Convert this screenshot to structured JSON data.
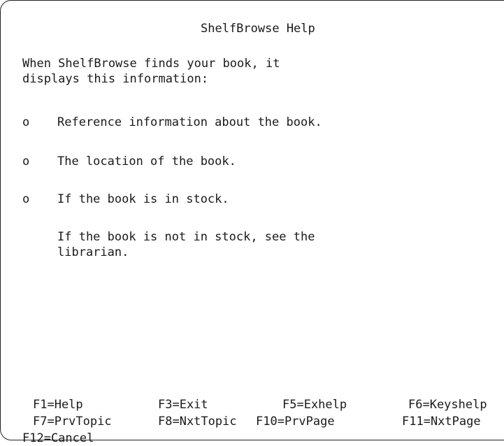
{
  "screen": {
    "title": "ShelfBrowse Help",
    "intro_line1": "When ShelfBrowse finds your book, it",
    "intro_line2": "displays this information:",
    "bullet_marker": "o",
    "bullets": [
      "Reference information about the book.",
      "The location of the book.",
      "If the book is in stock."
    ],
    "note_line1": "If the book is not in stock, see the",
    "note_line2": "librarian."
  },
  "function_keys": {
    "f1": "F1=Help",
    "f3": "F3=Exit",
    "f5": "F5=Exhelp",
    "f6": "F6=Keyshelp",
    "f7": "F7=PrvTopic",
    "f8": "F8=NxtTopic",
    "f10": "F10=PrvPage",
    "f11": "F11=NxtPage",
    "f12": "F12=Cancel"
  }
}
